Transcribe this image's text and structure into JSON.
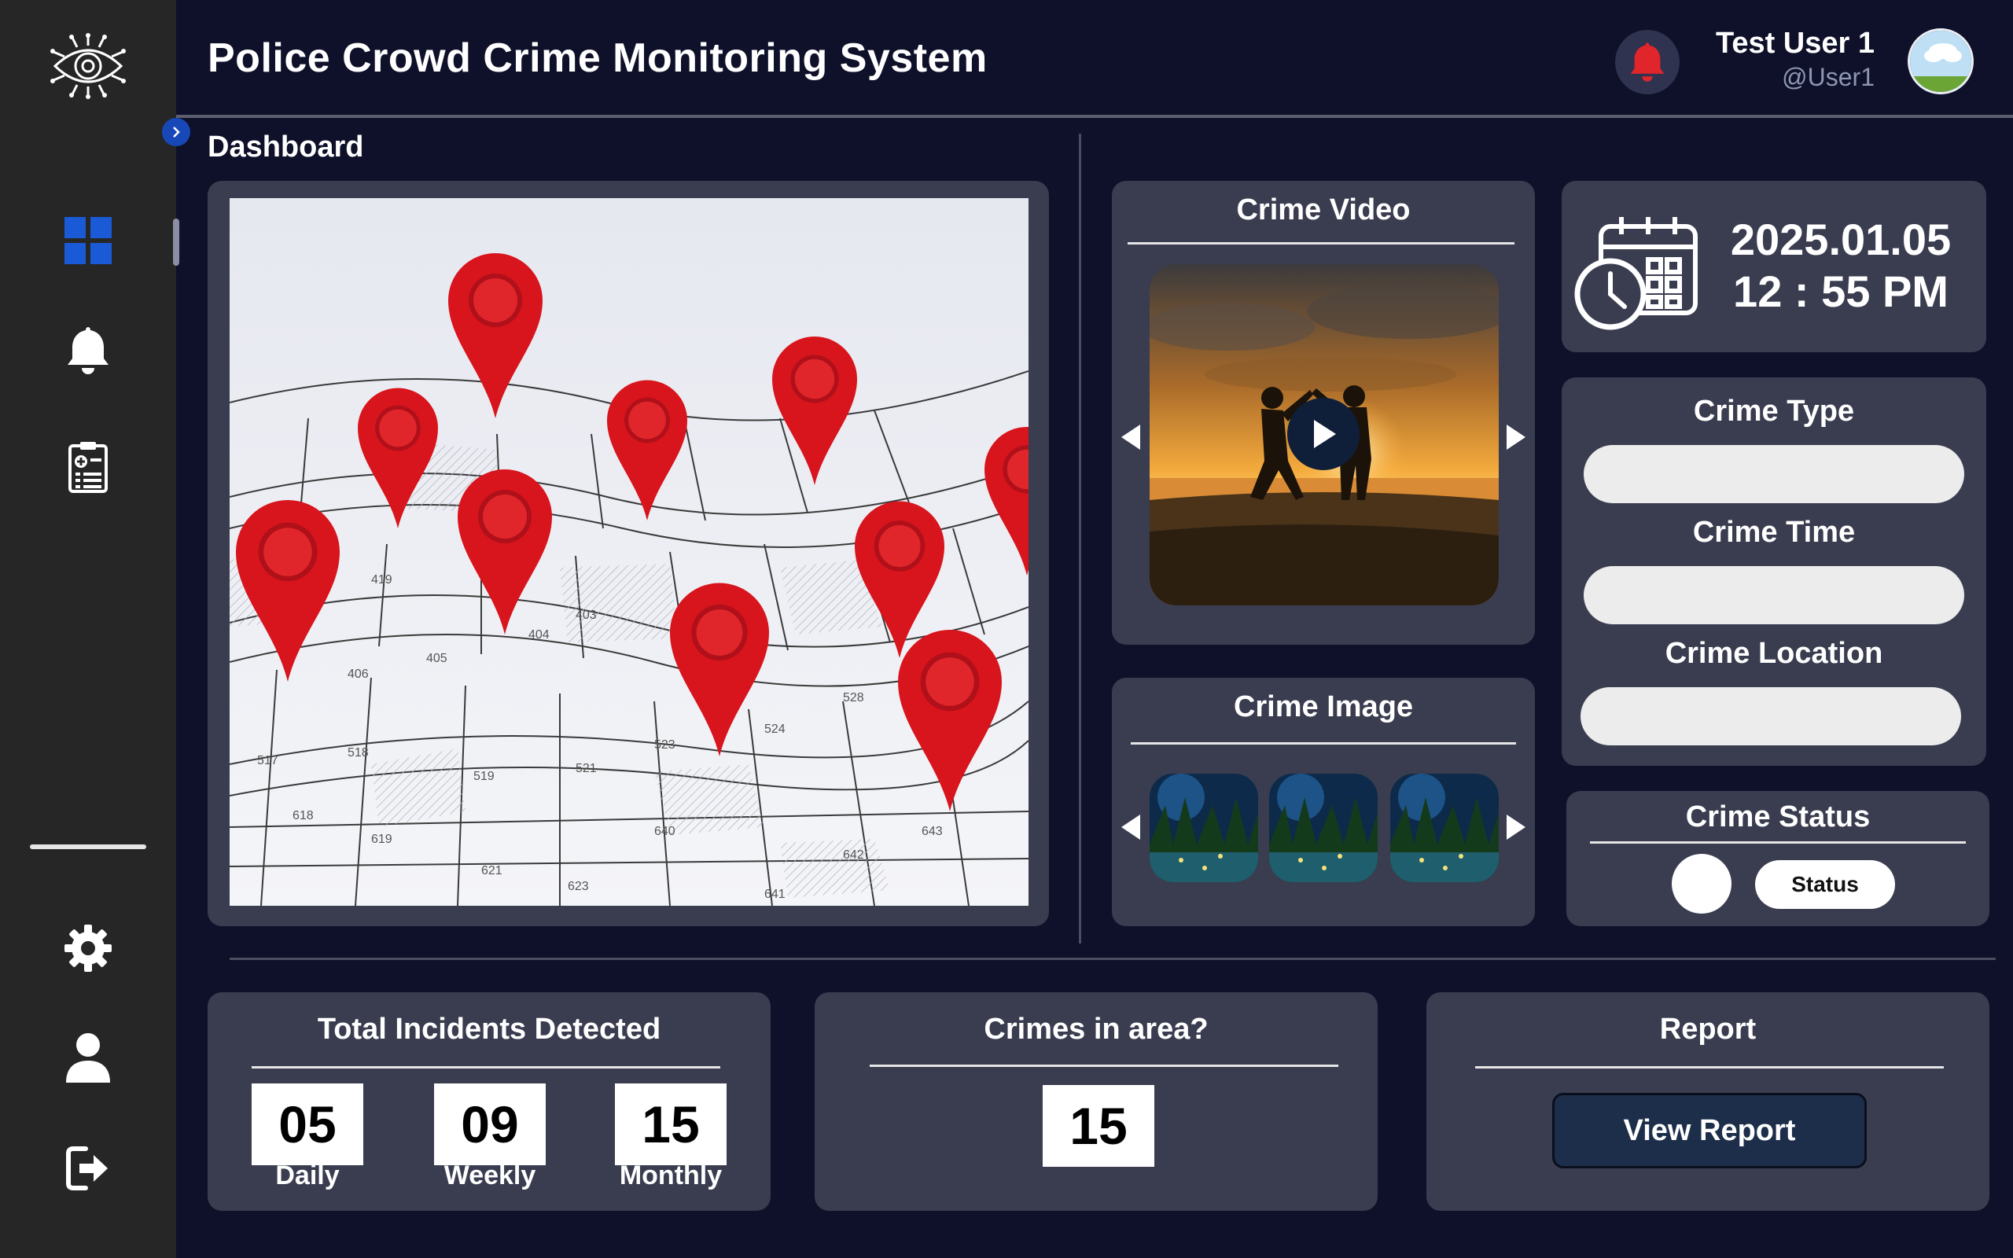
{
  "header": {
    "title": "Police Crowd Crime Monitoring System",
    "user_name": "Test User 1",
    "user_handle": "@User1"
  },
  "page": {
    "title": "Dashboard"
  },
  "sidebar": {
    "items": [
      {
        "icon": "dashboard-icon",
        "active": true
      },
      {
        "icon": "bell-icon"
      },
      {
        "icon": "clipboard-icon"
      },
      {
        "icon": "gear-icon"
      },
      {
        "icon": "user-icon"
      },
      {
        "icon": "logout-icon"
      }
    ]
  },
  "video": {
    "title": "Crime Video"
  },
  "images": {
    "title": "Crime Image"
  },
  "datetime": {
    "date": "2025.01.05",
    "time": "12 : 55  PM"
  },
  "details": {
    "type_label": "Crime Type",
    "time_label": "Crime Time",
    "location_label": "Crime Location",
    "type_value": "",
    "time_value": "",
    "location_value": ""
  },
  "status": {
    "title": "Crime Status",
    "button_label": "Status"
  },
  "incidents": {
    "title": "Total Incidents Detected",
    "daily": "05",
    "daily_label": "Daily",
    "weekly": "09",
    "weekly_label": "Weekly",
    "monthly": "15",
    "monthly_label": "Monthly"
  },
  "area": {
    "title": "Crimes in area?",
    "count": "15"
  },
  "report": {
    "title": "Report",
    "button_label": "View Report"
  },
  "colors": {
    "background": "#0e1129",
    "sidebar": "#262626",
    "card": "#3a3d50",
    "accent_blue": "#1848b8",
    "alert_red": "#e0262b"
  }
}
